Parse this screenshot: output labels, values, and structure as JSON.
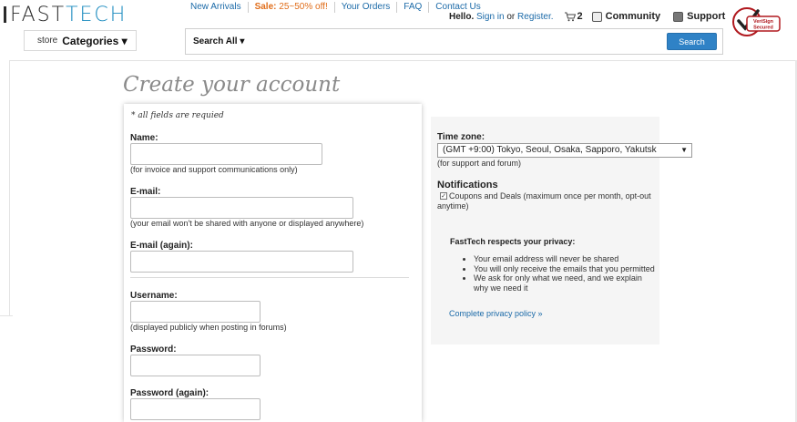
{
  "header": {
    "logo_fast": "FAST",
    "logo_tech": "TECH",
    "nav": [
      {
        "label": "New Arrivals"
      },
      {
        "label_prefix": "Sale:",
        "label": " 25~50% off!"
      },
      {
        "label": "Your Orders"
      },
      {
        "label": "FAQ"
      },
      {
        "label": "Contact Us"
      }
    ],
    "hello": "Hello.",
    "sign_in": "Sign in",
    "or": " or ",
    "register": "Register.",
    "cart_count": "2",
    "community": "Community",
    "support": "Support",
    "verisign_line1": "VeriSign",
    "verisign_line2": "Secured"
  },
  "categories": {
    "prefix": "store",
    "label": "Categories ▾"
  },
  "search": {
    "scope": "Search All ▾",
    "button": "Search"
  },
  "page_title": "Create your account",
  "form": {
    "required_note": "* all fields are requied",
    "name_label": "Name:",
    "name_hint": "(for invoice and support communications only)",
    "email_label": "E-mail:",
    "email_hint": "(your email won't be shared with anyone or displayed anywhere)",
    "email_again_label": "E-mail (again):",
    "username_label": "Username:",
    "username_hint": "(displayed publicly when posting in forums)",
    "password_label": "Password:",
    "password_again_label": "Password (again):"
  },
  "settings": {
    "timezone_label": "Time zone:",
    "timezone_value": "(GMT +9:00) Tokyo, Seoul, Osaka, Sapporo, Yakutsk",
    "timezone_hint": "(for support and forum)",
    "notifications_label": "Notifications",
    "coupons_text": "Coupons and Deals (maximum once per month, opt-out anytime)",
    "coupons_checked": true
  },
  "privacy": {
    "title": "FastTech respects your privacy:",
    "items": [
      "Your email address will never be shared",
      "You will only receive the emails that you permitted",
      "We ask for only what we need, and we explain why we need it"
    ],
    "link": "Complete privacy policy »"
  }
}
